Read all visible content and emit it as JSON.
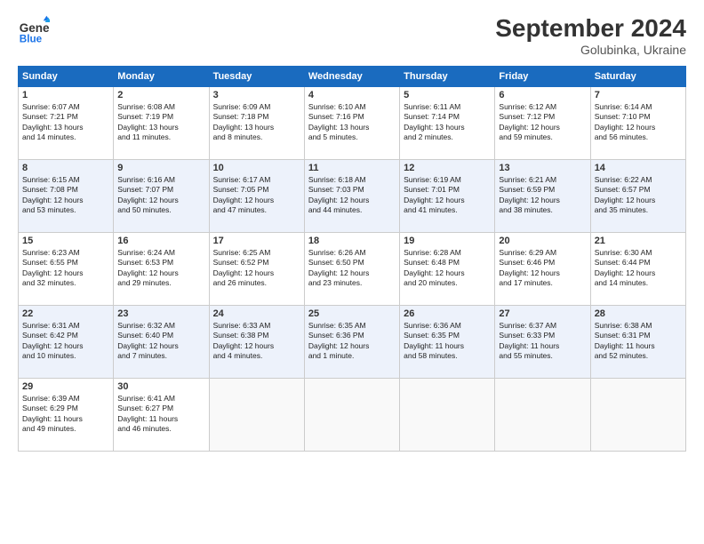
{
  "header": {
    "logo_line1": "General",
    "logo_line2": "Blue",
    "month_title": "September 2024",
    "location": "Golubinka, Ukraine"
  },
  "days_of_week": [
    "Sunday",
    "Monday",
    "Tuesday",
    "Wednesday",
    "Thursday",
    "Friday",
    "Saturday"
  ],
  "weeks": [
    [
      {
        "day": 1,
        "lines": [
          "Sunrise: 6:07 AM",
          "Sunset: 7:21 PM",
          "Daylight: 13 hours",
          "and 14 minutes."
        ]
      },
      {
        "day": 2,
        "lines": [
          "Sunrise: 6:08 AM",
          "Sunset: 7:19 PM",
          "Daylight: 13 hours",
          "and 11 minutes."
        ]
      },
      {
        "day": 3,
        "lines": [
          "Sunrise: 6:09 AM",
          "Sunset: 7:18 PM",
          "Daylight: 13 hours",
          "and 8 minutes."
        ]
      },
      {
        "day": 4,
        "lines": [
          "Sunrise: 6:10 AM",
          "Sunset: 7:16 PM",
          "Daylight: 13 hours",
          "and 5 minutes."
        ]
      },
      {
        "day": 5,
        "lines": [
          "Sunrise: 6:11 AM",
          "Sunset: 7:14 PM",
          "Daylight: 13 hours",
          "and 2 minutes."
        ]
      },
      {
        "day": 6,
        "lines": [
          "Sunrise: 6:12 AM",
          "Sunset: 7:12 PM",
          "Daylight: 12 hours",
          "and 59 minutes."
        ]
      },
      {
        "day": 7,
        "lines": [
          "Sunrise: 6:14 AM",
          "Sunset: 7:10 PM",
          "Daylight: 12 hours",
          "and 56 minutes."
        ]
      }
    ],
    [
      {
        "day": 8,
        "lines": [
          "Sunrise: 6:15 AM",
          "Sunset: 7:08 PM",
          "Daylight: 12 hours",
          "and 53 minutes."
        ]
      },
      {
        "day": 9,
        "lines": [
          "Sunrise: 6:16 AM",
          "Sunset: 7:07 PM",
          "Daylight: 12 hours",
          "and 50 minutes."
        ]
      },
      {
        "day": 10,
        "lines": [
          "Sunrise: 6:17 AM",
          "Sunset: 7:05 PM",
          "Daylight: 12 hours",
          "and 47 minutes."
        ]
      },
      {
        "day": 11,
        "lines": [
          "Sunrise: 6:18 AM",
          "Sunset: 7:03 PM",
          "Daylight: 12 hours",
          "and 44 minutes."
        ]
      },
      {
        "day": 12,
        "lines": [
          "Sunrise: 6:19 AM",
          "Sunset: 7:01 PM",
          "Daylight: 12 hours",
          "and 41 minutes."
        ]
      },
      {
        "day": 13,
        "lines": [
          "Sunrise: 6:21 AM",
          "Sunset: 6:59 PM",
          "Daylight: 12 hours",
          "and 38 minutes."
        ]
      },
      {
        "day": 14,
        "lines": [
          "Sunrise: 6:22 AM",
          "Sunset: 6:57 PM",
          "Daylight: 12 hours",
          "and 35 minutes."
        ]
      }
    ],
    [
      {
        "day": 15,
        "lines": [
          "Sunrise: 6:23 AM",
          "Sunset: 6:55 PM",
          "Daylight: 12 hours",
          "and 32 minutes."
        ]
      },
      {
        "day": 16,
        "lines": [
          "Sunrise: 6:24 AM",
          "Sunset: 6:53 PM",
          "Daylight: 12 hours",
          "and 29 minutes."
        ]
      },
      {
        "day": 17,
        "lines": [
          "Sunrise: 6:25 AM",
          "Sunset: 6:52 PM",
          "Daylight: 12 hours",
          "and 26 minutes."
        ]
      },
      {
        "day": 18,
        "lines": [
          "Sunrise: 6:26 AM",
          "Sunset: 6:50 PM",
          "Daylight: 12 hours",
          "and 23 minutes."
        ]
      },
      {
        "day": 19,
        "lines": [
          "Sunrise: 6:28 AM",
          "Sunset: 6:48 PM",
          "Daylight: 12 hours",
          "and 20 minutes."
        ]
      },
      {
        "day": 20,
        "lines": [
          "Sunrise: 6:29 AM",
          "Sunset: 6:46 PM",
          "Daylight: 12 hours",
          "and 17 minutes."
        ]
      },
      {
        "day": 21,
        "lines": [
          "Sunrise: 6:30 AM",
          "Sunset: 6:44 PM",
          "Daylight: 12 hours",
          "and 14 minutes."
        ]
      }
    ],
    [
      {
        "day": 22,
        "lines": [
          "Sunrise: 6:31 AM",
          "Sunset: 6:42 PM",
          "Daylight: 12 hours",
          "and 10 minutes."
        ]
      },
      {
        "day": 23,
        "lines": [
          "Sunrise: 6:32 AM",
          "Sunset: 6:40 PM",
          "Daylight: 12 hours",
          "and 7 minutes."
        ]
      },
      {
        "day": 24,
        "lines": [
          "Sunrise: 6:33 AM",
          "Sunset: 6:38 PM",
          "Daylight: 12 hours",
          "and 4 minutes."
        ]
      },
      {
        "day": 25,
        "lines": [
          "Sunrise: 6:35 AM",
          "Sunset: 6:36 PM",
          "Daylight: 12 hours",
          "and 1 minute."
        ]
      },
      {
        "day": 26,
        "lines": [
          "Sunrise: 6:36 AM",
          "Sunset: 6:35 PM",
          "Daylight: 11 hours",
          "and 58 minutes."
        ]
      },
      {
        "day": 27,
        "lines": [
          "Sunrise: 6:37 AM",
          "Sunset: 6:33 PM",
          "Daylight: 11 hours",
          "and 55 minutes."
        ]
      },
      {
        "day": 28,
        "lines": [
          "Sunrise: 6:38 AM",
          "Sunset: 6:31 PM",
          "Daylight: 11 hours",
          "and 52 minutes."
        ]
      }
    ],
    [
      {
        "day": 29,
        "lines": [
          "Sunrise: 6:39 AM",
          "Sunset: 6:29 PM",
          "Daylight: 11 hours",
          "and 49 minutes."
        ]
      },
      {
        "day": 30,
        "lines": [
          "Sunrise: 6:41 AM",
          "Sunset: 6:27 PM",
          "Daylight: 11 hours",
          "and 46 minutes."
        ]
      },
      null,
      null,
      null,
      null,
      null
    ]
  ]
}
